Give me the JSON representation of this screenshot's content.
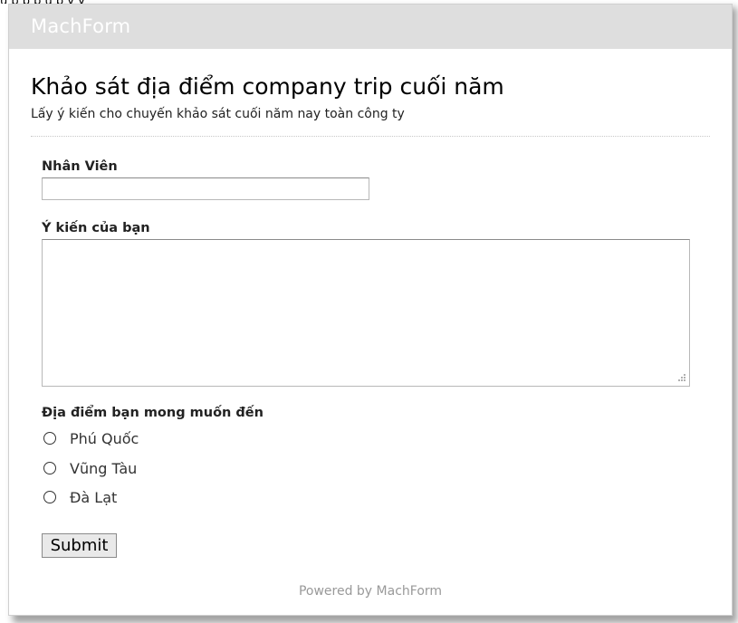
{
  "top_strip_text": "ụ   p   p               p                                      ụ  p  ỵ  ỵ",
  "header": {
    "logo": "MachForm"
  },
  "form": {
    "title": "Khảo sát địa điểm company trip cuối năm",
    "description": "Lấy ý kiến cho chuyến khảo sát cuối năm nay toàn công ty",
    "fields": {
      "employee": {
        "label": "Nhân Viên",
        "value": ""
      },
      "opinion": {
        "label": "Ý kiến của bạn",
        "value": ""
      },
      "location": {
        "label": "Địa điểm bạn mong muốn đến",
        "options": [
          "Phú Quốc",
          "Vũng Tàu",
          "Đà Lạt"
        ],
        "selected": null
      }
    },
    "submit_label": "Submit"
  },
  "footer": {
    "text": "Powered by MachForm"
  },
  "colors": {
    "header_bg": "#dedede",
    "logo_color": "#ffffff",
    "footer_text": "#999999"
  }
}
